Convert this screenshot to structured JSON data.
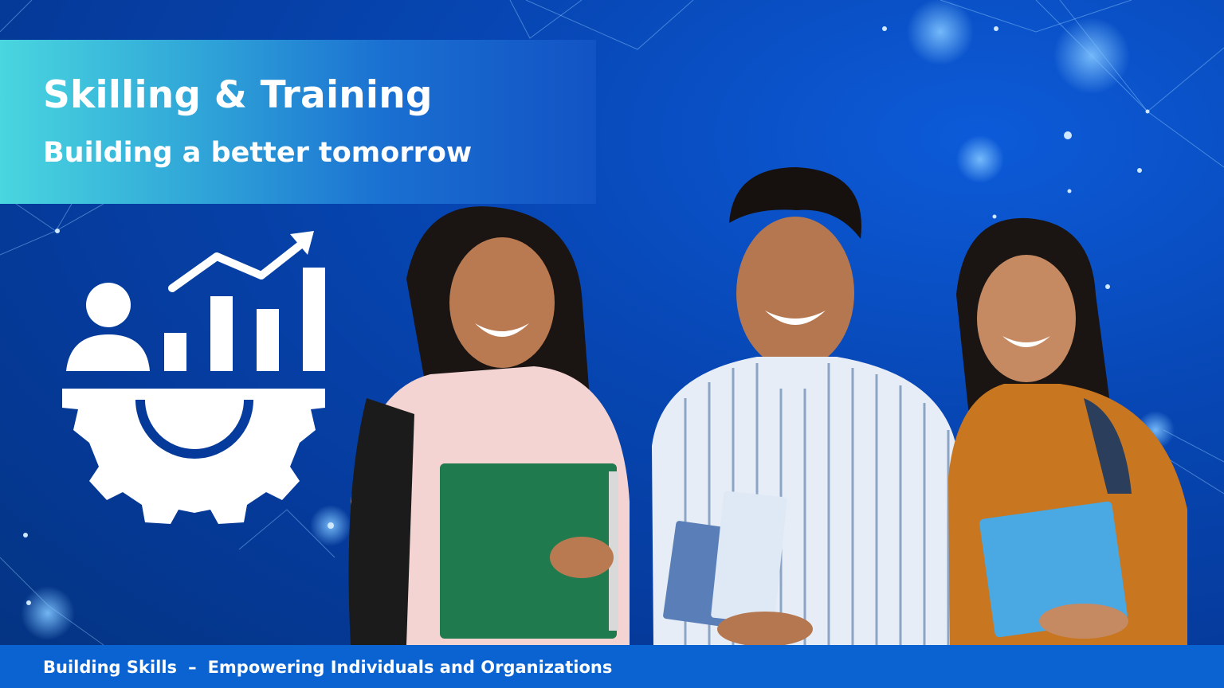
{
  "hero": {
    "title": "Skilling & Training",
    "subtitle": "Building a better tomorrow"
  },
  "footer": {
    "left": "Building Skills",
    "separator": "–",
    "right": "Empowering Individuals and Organizations"
  },
  "icons": {
    "skill_growth": "skill-growth-gear-icon"
  },
  "colors": {
    "background": "#0747b5",
    "banner_start": "#49d6df",
    "banner_end": "#1253c4",
    "footer_bar": "#0b63d1",
    "text": "#ffffff"
  }
}
